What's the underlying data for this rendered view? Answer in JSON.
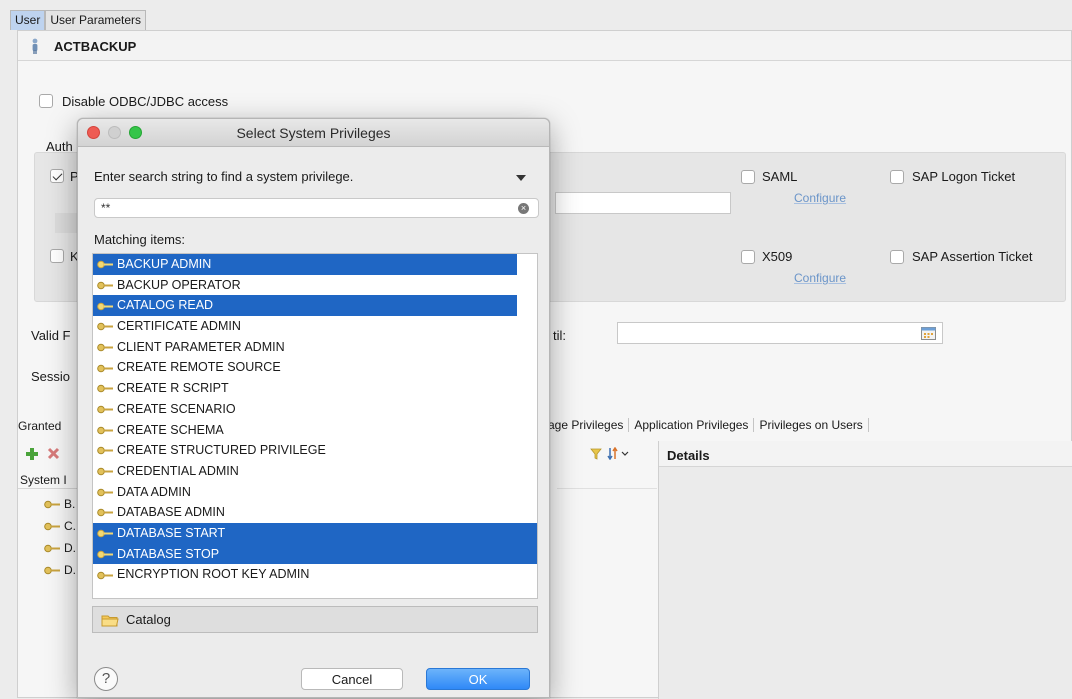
{
  "tabs": [
    {
      "label": "User",
      "active": true
    },
    {
      "label": "User Parameters",
      "active": false
    }
  ],
  "user": {
    "name": "ACTBACKUP"
  },
  "disable_odbc": {
    "label": "Disable ODBC/JDBC access",
    "checked": false
  },
  "auth": {
    "label_partial": "Auth",
    "password_partial": "P",
    "password_checked": true,
    "kerberos_partial": "K",
    "kerberos_checked": false,
    "saml": {
      "label": "SAML",
      "configure": "Configure",
      "checked": false
    },
    "sap_logon": {
      "label": "SAP Logon Ticket",
      "checked": false
    },
    "x509": {
      "label": "X509",
      "configure": "Configure",
      "checked": false
    },
    "sap_assertion": {
      "label": "SAP Assertion Ticket",
      "checked": false
    }
  },
  "validity": {
    "valid_from_partial": "Valid F",
    "until_partial": "til:",
    "session_partial": "Sessio"
  },
  "privilege_tabs": {
    "granted_partial": "Granted",
    "items": [
      "kage Privileges",
      "Application Privileges",
      "Privileges on Users"
    ]
  },
  "left_panel": {
    "header_partial": "System I",
    "rows": [
      "B.",
      "C.",
      "D.",
      "D."
    ]
  },
  "details": {
    "title": "Details"
  },
  "dialog": {
    "title": "Select System Privileges",
    "prompt": "Enter search string to find a system privilege.",
    "search_value": "**",
    "matching_label": "Matching items:",
    "items": [
      {
        "label": "BACKUP ADMIN",
        "selected": true,
        "width": "narrow"
      },
      {
        "label": "BACKUP OPERATOR",
        "selected": false
      },
      {
        "label": "CATALOG READ",
        "selected": true,
        "width": "narrow"
      },
      {
        "label": "CERTIFICATE ADMIN",
        "selected": false
      },
      {
        "label": "CLIENT PARAMETER ADMIN",
        "selected": false
      },
      {
        "label": "CREATE REMOTE SOURCE",
        "selected": false
      },
      {
        "label": "CREATE R SCRIPT",
        "selected": false
      },
      {
        "label": "CREATE SCENARIO",
        "selected": false
      },
      {
        "label": "CREATE SCHEMA",
        "selected": false
      },
      {
        "label": "CREATE STRUCTURED PRIVILEGE",
        "selected": false
      },
      {
        "label": "CREDENTIAL ADMIN",
        "selected": false
      },
      {
        "label": "DATA ADMIN",
        "selected": false
      },
      {
        "label": "DATABASE ADMIN",
        "selected": false
      },
      {
        "label": "DATABASE START",
        "selected": true,
        "width": "wide"
      },
      {
        "label": "DATABASE STOP",
        "selected": true,
        "width": "wide"
      },
      {
        "label": "ENCRYPTION ROOT KEY ADMIN",
        "selected": false
      }
    ],
    "catalog_label": "Catalog",
    "help_label": "?",
    "cancel_label": "Cancel",
    "ok_label": "OK"
  },
  "colors": {
    "selection": "#1f66c4",
    "active_tab": "#bed3ef",
    "ok_button": "#2f89f7"
  }
}
